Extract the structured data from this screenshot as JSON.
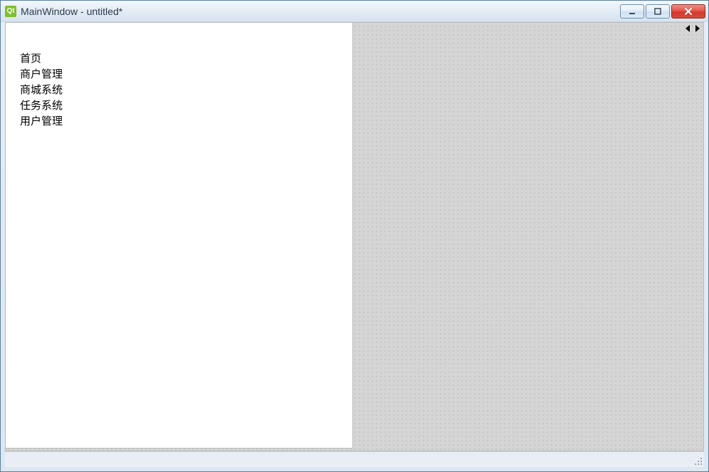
{
  "window": {
    "title": "MainWindow - untitled*",
    "app_icon_label": "Qt"
  },
  "list": {
    "items": [
      {
        "label": "首页"
      },
      {
        "label": "商户管理"
      },
      {
        "label": "商城系统"
      },
      {
        "label": "任务系统"
      },
      {
        "label": "用户管理"
      }
    ]
  }
}
